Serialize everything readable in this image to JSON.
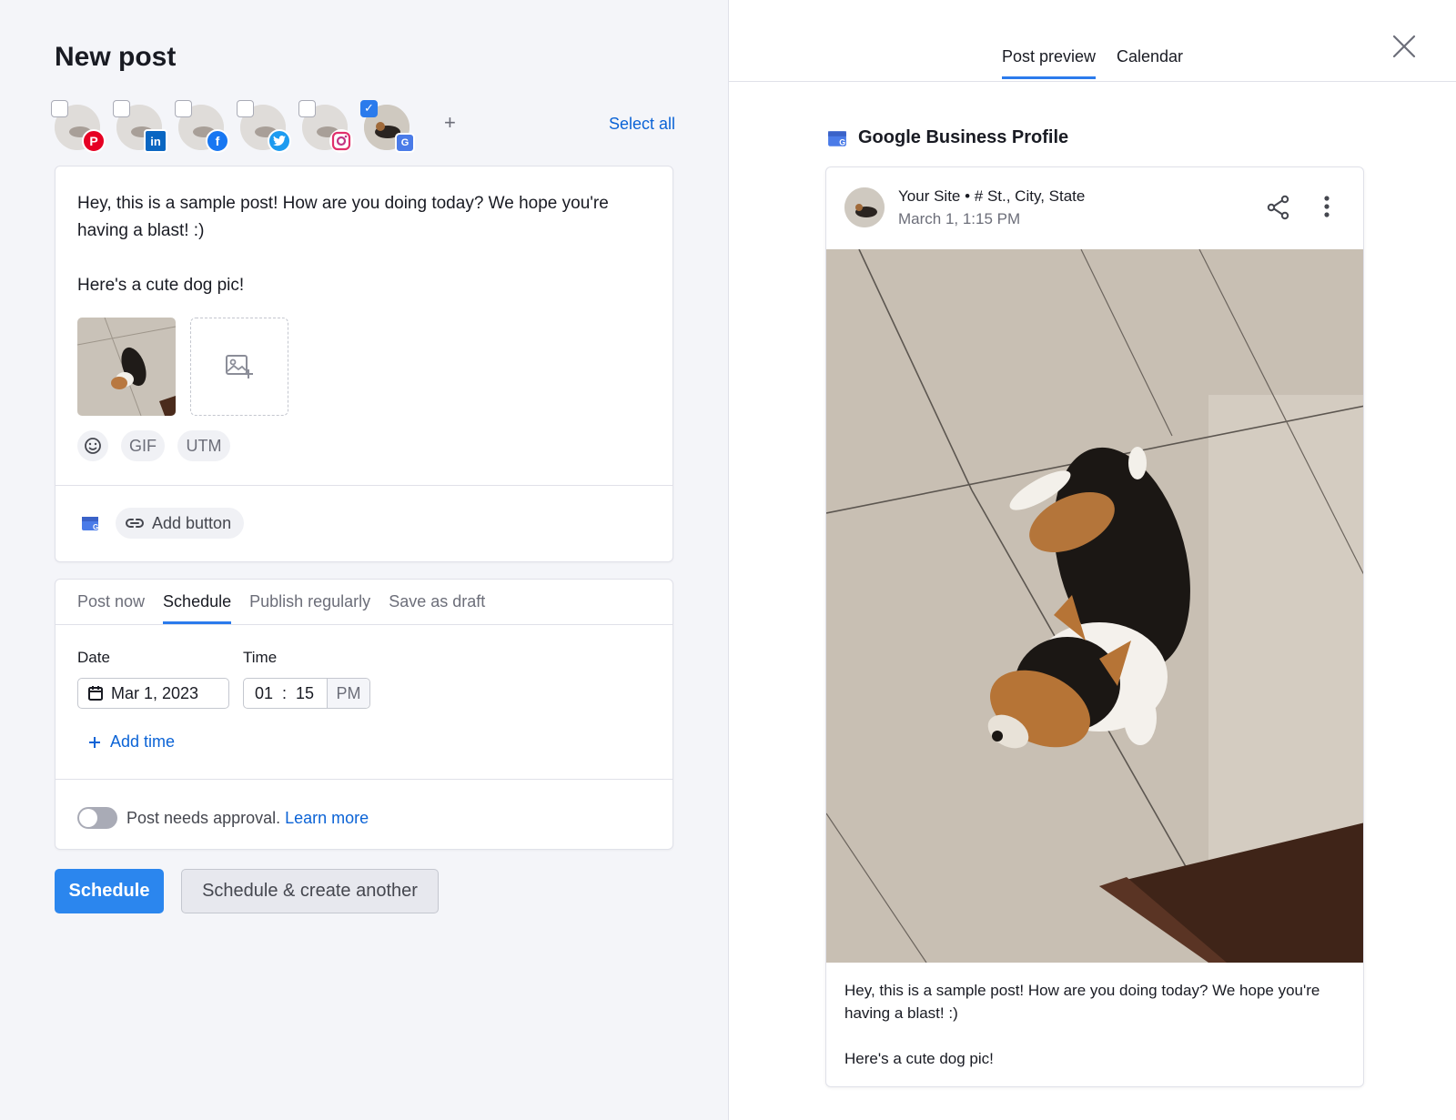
{
  "composer": {
    "title": "New post",
    "select_all": "Select all",
    "add_account": "+",
    "accounts": [
      {
        "network": "pinterest-icon",
        "checked": false,
        "color": "#e60023",
        "glyph": "P"
      },
      {
        "network": "linkedin-icon",
        "checked": false,
        "color": "#0a66c2",
        "glyph": "in"
      },
      {
        "network": "facebook-icon",
        "checked": false,
        "color": "#1877f2",
        "glyph": "f"
      },
      {
        "network": "twitter-icon",
        "checked": false,
        "color": "#1d9bf0",
        "glyph": "t"
      },
      {
        "network": "instagram-icon",
        "checked": false,
        "color": "#e1306c",
        "glyph": "◎"
      },
      {
        "network": "google-business-icon",
        "checked": true,
        "color": "#4a7be8",
        "glyph": "G"
      }
    ],
    "text": "Hey, this is a sample post! How are you doing today? We hope you're having a blast! :)\n\nHere's a cute dog pic!",
    "chips": {
      "gif": "GIF",
      "utm": "UTM"
    },
    "add_button": "Add button"
  },
  "schedule": {
    "tabs": [
      "Post now",
      "Schedule",
      "Publish regularly",
      "Save as draft"
    ],
    "active_tab": "Schedule",
    "date_label": "Date",
    "time_label": "Time",
    "date_value": "Mar 1, 2023",
    "hour": "01",
    "sep": ":",
    "minute": "15",
    "ampm": "PM",
    "add_time": "Add time",
    "approval_text": "Post needs approval.",
    "learn_more": "Learn more"
  },
  "actions": {
    "primary": "Schedule",
    "secondary": "Schedule & create another"
  },
  "preview": {
    "tabs": [
      "Post preview",
      "Calendar"
    ],
    "platform": "Google Business Profile",
    "site": "Your Site • # St., City, State",
    "date": "March 1, 1:15 PM",
    "text": "Hey, this is a sample post! How are you doing today? We hope you're having a blast! :)\n\nHere's a cute dog pic!"
  },
  "colors": {
    "accent": "#2b7bec",
    "link": "#0b63d6",
    "primary_button": "#2b86ee"
  }
}
